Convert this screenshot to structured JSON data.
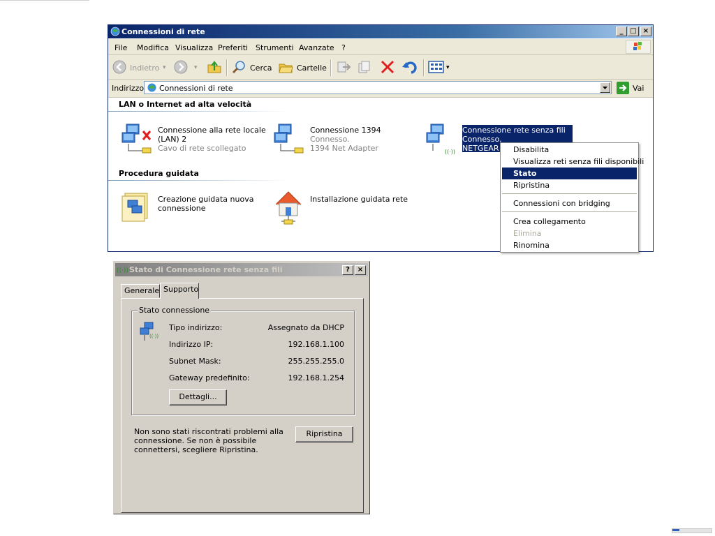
{
  "explorer": {
    "title": "Connessioni di rete",
    "menu": [
      "File",
      "Modifica",
      "Visualizza",
      "Preferiti",
      "Strumenti",
      "Avanzate",
      "?"
    ],
    "toolbar": {
      "back": "Indietro",
      "search": "Cerca",
      "folders": "Cartelle"
    },
    "address": {
      "label": "Indirizzo",
      "value": "Connessioni di rete",
      "go": "Vai"
    },
    "groups": {
      "lan": "LAN o Internet ad alta velocità",
      "wizard": "Procedura guidata"
    },
    "connections": [
      {
        "title1": "Connessione alla rete locale",
        "title2": "(LAN) 2",
        "status": "Cavo di rete scollegato"
      },
      {
        "title1": "Connessione 1394",
        "status": "Connesso.",
        "device": "1394 Net Adapter"
      },
      {
        "title1": "Connessione rete senza fili",
        "status": "Connesso.",
        "device": "NETGEAR N"
      }
    ],
    "wizards": [
      {
        "title1": "Creazione guidata nuova",
        "title2": "connessione"
      },
      {
        "title1": "Installazione guidata rete"
      }
    ]
  },
  "context_menu": {
    "items": [
      {
        "label": "Disabilita"
      },
      {
        "label": "Visualizza reti senza fili disponibili"
      },
      {
        "label": "Stato",
        "highlighted": true
      },
      {
        "label": "Ripristina"
      },
      {
        "label": "Connessioni con bridging"
      },
      {
        "label": "Crea collegamento"
      },
      {
        "label": "Elimina",
        "disabled": true
      },
      {
        "label": "Rinomina"
      }
    ]
  },
  "status_dialog": {
    "title": "Stato di Connessione rete senza fili",
    "help": "?",
    "tabs": [
      "Generale",
      "Supporto"
    ],
    "active_tab": "Supporto",
    "group_label": "Stato connessione",
    "rows": [
      {
        "label": "Tipo indirizzo:",
        "value": "Assegnato da DHCP"
      },
      {
        "label": "Indirizzo IP:",
        "value": "192.168.1.100"
      },
      {
        "label": "Subnet Mask:",
        "value": "255.255.255.0"
      },
      {
        "label": "Gateway predefinito:",
        "value": "192.168.1.254"
      }
    ],
    "details_button": "Dettagli...",
    "note": "Non sono stati riscontrati problemi alla connessione. Se non è possibile connettersi, scegliere Ripristina.",
    "repair_button": "Ripristina"
  },
  "colors": {
    "titlebar_active": "#0a246a",
    "selection": "#0a246a",
    "dialog_face": "#d4d0c8"
  }
}
